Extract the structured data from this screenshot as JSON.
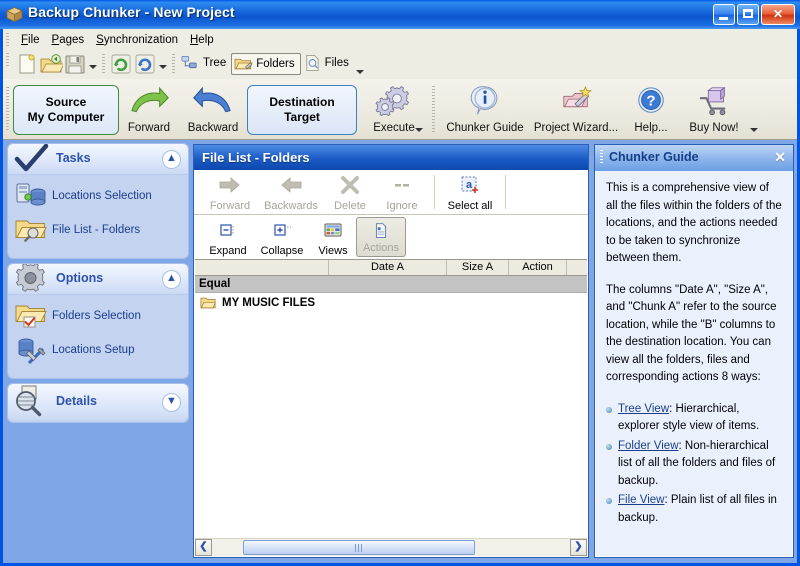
{
  "window": {
    "title": "Backup Chunker - New Project",
    "icon": "box-icon",
    "minimize_label": "_",
    "maximize_label": "□",
    "close_label": "✕"
  },
  "menubar": {
    "items": [
      {
        "label": "File",
        "accel": "F"
      },
      {
        "label": "Pages",
        "accel": "P"
      },
      {
        "label": "Synchronization",
        "accel": "S"
      },
      {
        "label": "Help",
        "accel": "H"
      }
    ]
  },
  "small_toolbar": {
    "buttons": [
      {
        "name": "new-icon",
        "label": ""
      },
      {
        "name": "open-folder-icon",
        "label": ""
      },
      {
        "name": "save-icon",
        "label": ""
      }
    ],
    "refresh_buttons": [
      {
        "name": "refresh-green-icon",
        "label": ""
      },
      {
        "name": "refresh-blue-icon",
        "label": ""
      }
    ],
    "views": [
      {
        "name": "tree-view-button",
        "label": "Tree",
        "active": false
      },
      {
        "name": "folders-view-button",
        "label": "Folders",
        "active": true
      },
      {
        "name": "files-view-button",
        "label": "Files",
        "active": false
      }
    ]
  },
  "big_toolbar": {
    "source_line1": "Source",
    "source_line2": "My Computer",
    "forward_label": "Forward",
    "backward_label": "Backward",
    "destination_line1": "Destination",
    "destination_line2": "Target",
    "execute_label": "Execute",
    "chunker_guide_label": "Chunker Guide",
    "project_wizard_label": "Project Wizard...",
    "help_label": "Help...",
    "buy_now_label": "Buy Now!"
  },
  "sidebar": {
    "groups": [
      {
        "title": "Tasks",
        "icon": "checkmark-icon",
        "chevron": "⌃",
        "expanded": true,
        "items": [
          {
            "label": "Locations Selection",
            "icon": "server-database-icon"
          },
          {
            "label": "File List - Folders",
            "icon": "folder-search-icon"
          }
        ]
      },
      {
        "title": "Options",
        "icon": "gear-icon",
        "chevron": "⌃",
        "expanded": true,
        "items": [
          {
            "label": "Folders Selection",
            "icon": "folder-check-icon"
          },
          {
            "label": "Locations Setup",
            "icon": "database-tools-icon"
          }
        ]
      },
      {
        "title": "Details",
        "icon": "magnifier-document-icon",
        "chevron": "⌄",
        "expanded": false,
        "items": []
      }
    ]
  },
  "center_panel": {
    "title": "File List - Folders",
    "toolbar_row1": [
      {
        "label": "Forward",
        "icon": "arrow-right-icon",
        "disabled": true
      },
      {
        "label": "Backwards",
        "icon": "arrow-left-icon",
        "disabled": true
      },
      {
        "label": "Delete",
        "icon": "x-mark-icon",
        "disabled": true
      },
      {
        "label": "Ignore",
        "icon": "dashes-icon",
        "disabled": true
      },
      {
        "label": "Select all",
        "icon": "select-all-icon",
        "disabled": false
      }
    ],
    "toolbar_row2": [
      {
        "label": "Expand",
        "icon": "expand-icon",
        "active": false
      },
      {
        "label": "Collapse",
        "icon": "collapse-icon",
        "active": false
      },
      {
        "label": "Views",
        "icon": "views-grid-icon",
        "active": false
      },
      {
        "label": "Actions",
        "icon": "actions-document-icon",
        "active": true
      }
    ],
    "list_headers": [
      "",
      "Date A",
      "Size A",
      "Action",
      ""
    ],
    "group_row": "Equal",
    "rows": [
      {
        "name": "MY MUSIC FILES",
        "icon": "folder-icon",
        "date": "",
        "size": "",
        "action": ""
      }
    ],
    "scroll": {
      "left_arrow": "❮",
      "right_arrow": "❯"
    }
  },
  "guide_panel": {
    "title": "Chunker Guide",
    "close_label": "✕",
    "paragraphs": [
      "This is a comprehensive view of all the files within the folders of the locations, and the actions needed to be taken to synchronize between them.",
      "The columns \"Date  A\", \"Size  A\", and \"Chunk  A\" refer to the source location, while the \"B\"  columns   to the destination location. You can view all the folders, files and corresponding actions 8 ways:"
    ],
    "links": [
      {
        "label": "Tree View",
        "description": ": Hierarchical, explorer style view of items."
      },
      {
        "label": "Folder View",
        "description": ": Non-hierarchical list of all the folders and files of backup."
      },
      {
        "label": "File View",
        "description": ": Plain list of all files in backup."
      }
    ]
  },
  "colors": {
    "title_blue": "#0054E3",
    "workspace_blue": "#7FA7E8",
    "toolbar_beige": "#EEEDE4",
    "sidebar_body": "#C3D3F0",
    "guide_body": "#EAF1FC",
    "group_row_gray": "#C3C3C3",
    "link_blue": "#1B3E8C"
  }
}
